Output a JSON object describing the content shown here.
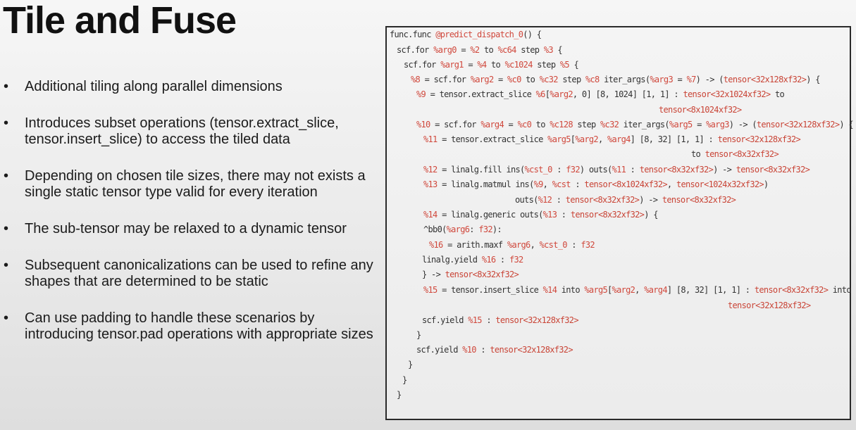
{
  "slide": {
    "title": "Tile and Fuse"
  },
  "bullets": [
    "Additional tiling along parallel dimensions",
    "Introduces subset operations (tensor.extract_slice, tensor.insert_slice) to access the tiled data",
    "Depending on chosen tile sizes, there may not exists a single static tensor type valid for every iteration",
    "The sub-tensor may be relaxed to a dynamic tensor",
    "Subsequent canonicalizations can be used to refine any shapes that are determined to be static",
    "Can use padding to handle these scenarios by introducing tensor.pad operations with appropriate sizes"
  ],
  "code": {
    "lines": [
      "func.func @predict_dispatch_0() {",
      "scf.for %arg0 = %2 to %c64 step %3 {",
      "scf.for %arg1 = %4 to %c1024 step %5 {",
      "%8 = scf.for %arg2 = %c0 to %c32 step %c8 iter_args(%arg3 = %7) -> (tensor<32x128xf32>) {",
      "%9 = tensor.extract_slice %6[%arg2, 0] [8, 1024] [1, 1] : tensor<32x1024xf32> to",
      "tensor<8x1024xf32>",
      "%10 = scf.for %arg4 = %c0 to %c128 step %c32 iter_args(%arg5 = %arg3) -> (tensor<32x128xf32>) {",
      "%11 = tensor.extract_slice %arg5[%arg2, %arg4] [8, 32] [1, 1] : tensor<32x128xf32>",
      "to tensor<8x32xf32>",
      "%12 = linalg.fill ins(%cst_0 : f32) outs(%11 : tensor<8x32xf32>) -> tensor<8x32xf32>",
      "%13 = linalg.matmul ins(%9, %cst : tensor<8x1024xf32>, tensor<1024x32xf32>)",
      "outs(%12 : tensor<8x32xf32>) -> tensor<8x32xf32>",
      "%14 = linalg.generic outs(%13 : tensor<8x32xf32>) {",
      "^bb0(%arg6: f32):",
      "%16 = arith.maxf %arg6, %cst_0 : f32",
      "linalg.yield %16 : f32",
      "} -> tensor<8x32xf32>",
      "%15 = tensor.insert_slice %14 into %arg5[%arg2, %arg4] [8, 32] [1, 1] : tensor<8x32xf32> into",
      "tensor<32x128xf32>",
      "scf.yield %15 : tensor<32x128xf32>",
      "}",
      "scf.yield %10 : tensor<32x128xf32>",
      "}",
      "}",
      "}"
    ]
  },
  "colors": {
    "code_keyword": "#333333",
    "code_variable": "#d0483c",
    "code_type": "#c94436"
  }
}
